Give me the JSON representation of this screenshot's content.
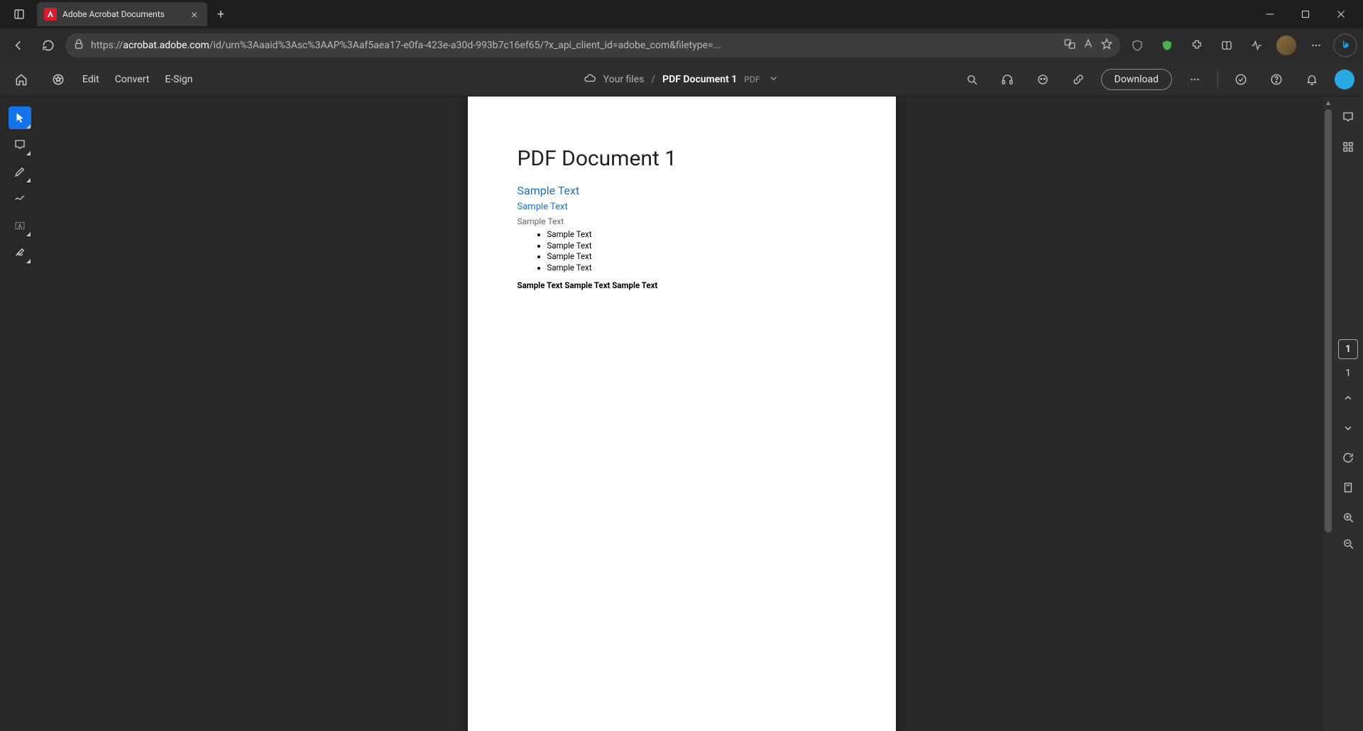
{
  "browser": {
    "tab_title": "Adobe Acrobat Documents",
    "url_prefix": "https://",
    "url_domain": "acrobat.adobe.com",
    "url_rest": "/id/urn%3Aaaid%3Asc%3AAP%3Aaf5aea17-e0fa-423e-a30d-993b7c16ef65/?x_api_client_id=adobe_com&filetype=..."
  },
  "appbar": {
    "menu": [
      "Edit",
      "Convert",
      "E-Sign"
    ],
    "breadcrumb_path": "Your files",
    "breadcrumb_file": "PDF Document 1",
    "breadcrumb_type": "PDF",
    "download_label": "Download"
  },
  "document": {
    "title": "PDF Document 1",
    "h2": "Sample Text",
    "h3": "Sample Text",
    "h4": "Sample Text",
    "bullets": [
      "Sample Text",
      "Sample Text",
      "Sample Text",
      "Sample Text"
    ],
    "bold_line": "Sample Text Sample Text Sample Text"
  },
  "paging": {
    "current": "1",
    "total": "1"
  }
}
